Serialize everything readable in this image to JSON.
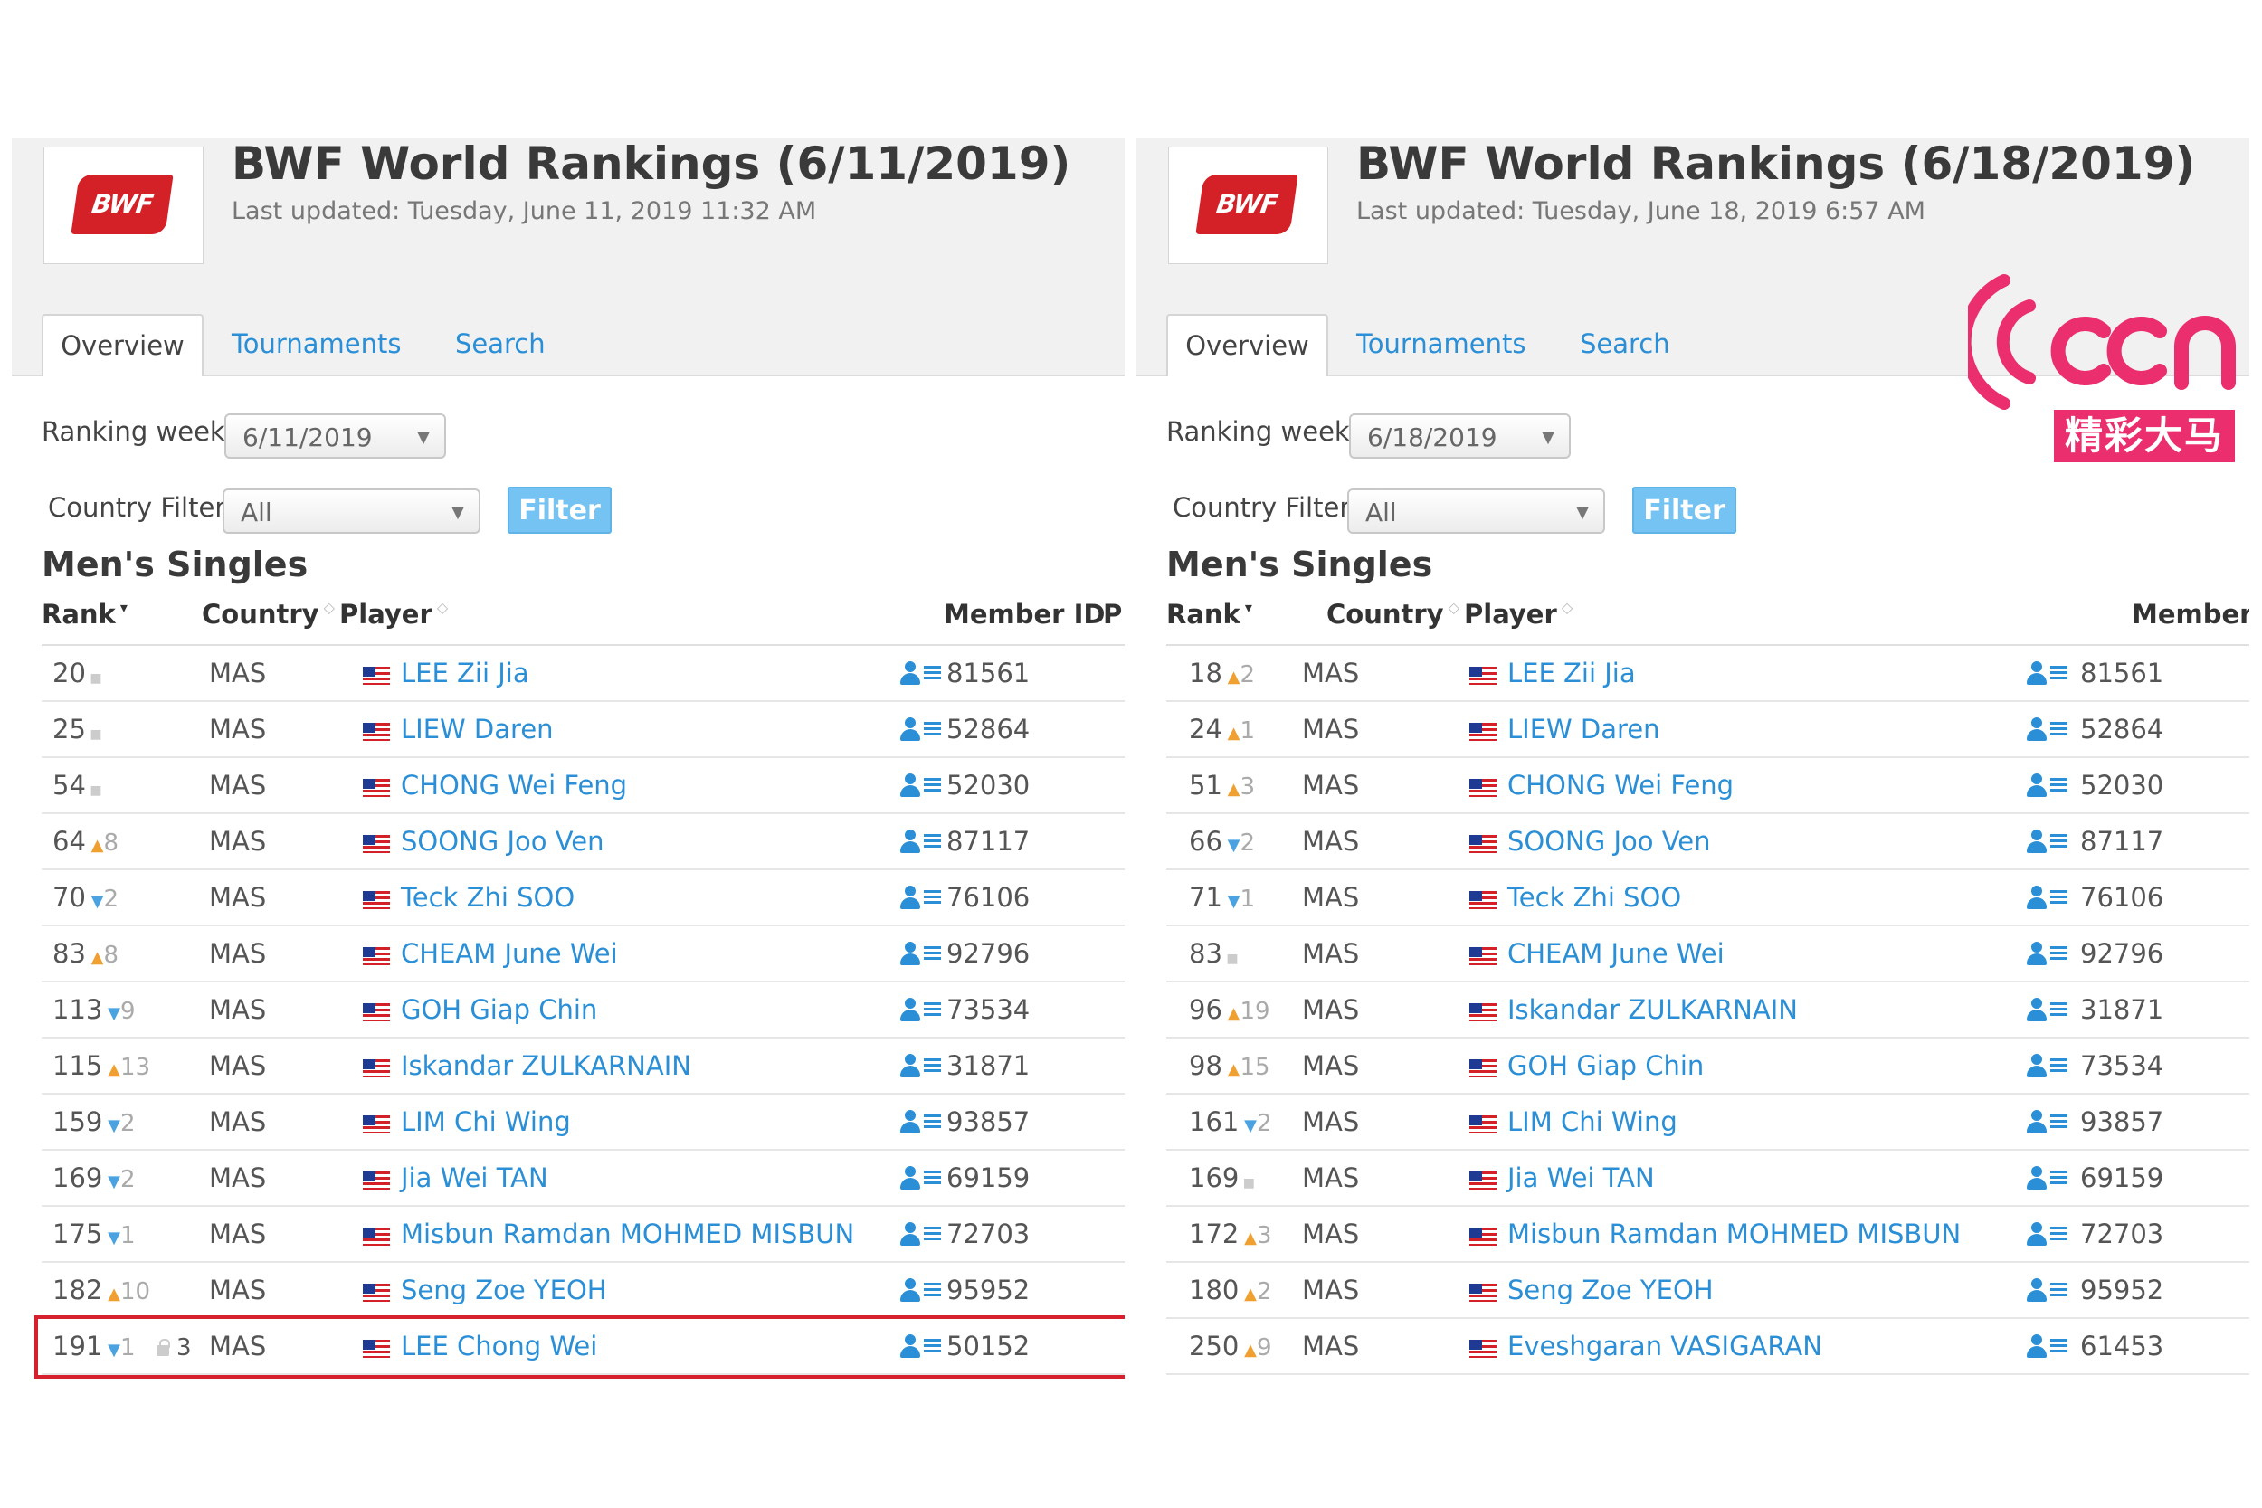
{
  "colors": {
    "link": "#2a8fd6",
    "brand_red": "#d42027",
    "filter_button": "#74c3f3",
    "highlight": "#d6202d",
    "up_arrow": "#f0a030",
    "down_arrow": "#4aa3e0",
    "ccn_pink": "#ea2e6e"
  },
  "icons": {
    "logo": "bwf-logo",
    "profile": "profile-list-icon",
    "flag": "malaysia-flag-icon",
    "sort": "sort-caret-icon",
    "dropdown": "caret-down-icon",
    "lock": "lock-icon",
    "watermark": "ccn-signal-logo"
  },
  "watermark": {
    "brand": "ccn",
    "label": "精彩大马"
  },
  "panels": [
    {
      "logo_text": "BWF",
      "title": "BWF World Rankings (6/11/2019)",
      "last_updated": "Last updated: Tuesday, June 11, 2019 11:32 AM",
      "tabs": {
        "overview": "Overview",
        "tournaments": "Tournaments",
        "search": "Search"
      },
      "ranking_week_label": "Ranking week:",
      "ranking_week_value": "6/11/2019",
      "country_filter_label": "Country Filter:",
      "country_filter_value": "All",
      "filter_button": "Filter",
      "section_title": "Men's Singles",
      "columns": {
        "rank": "Rank",
        "country": "Country",
        "player": "Player",
        "member_id": "Member ID",
        "extra": "P"
      },
      "rows": [
        {
          "rank": "20",
          "change": "",
          "dir": "none",
          "country": "MAS",
          "player": "LEE Zii Jia",
          "member_id": "81561"
        },
        {
          "rank": "25",
          "change": "",
          "dir": "none",
          "country": "MAS",
          "player": "LIEW Daren",
          "member_id": "52864"
        },
        {
          "rank": "54",
          "change": "",
          "dir": "none",
          "country": "MAS",
          "player": "CHONG Wei Feng",
          "member_id": "52030"
        },
        {
          "rank": "64",
          "change": "8",
          "dir": "up",
          "country": "MAS",
          "player": "SOONG Joo Ven",
          "member_id": "87117"
        },
        {
          "rank": "70",
          "change": "2",
          "dir": "down",
          "country": "MAS",
          "player": "Teck Zhi SOO",
          "member_id": "76106"
        },
        {
          "rank": "83",
          "change": "8",
          "dir": "up",
          "country": "MAS",
          "player": "CHEAM June Wei",
          "member_id": "92796"
        },
        {
          "rank": "113",
          "change": "9",
          "dir": "down",
          "country": "MAS",
          "player": "GOH Giap Chin",
          "member_id": "73534"
        },
        {
          "rank": "115",
          "change": "13",
          "dir": "up",
          "country": "MAS",
          "player": "Iskandar ZULKARNAIN",
          "member_id": "31871"
        },
        {
          "rank": "159",
          "change": "2",
          "dir": "down",
          "country": "MAS",
          "player": "LIM Chi Wing",
          "member_id": "93857"
        },
        {
          "rank": "169",
          "change": "2",
          "dir": "down",
          "country": "MAS",
          "player": "Jia Wei TAN",
          "member_id": "69159"
        },
        {
          "rank": "175",
          "change": "1",
          "dir": "down",
          "country": "MAS",
          "player": "Misbun Ramdan MOHMED MISBUN",
          "member_id": "72703"
        },
        {
          "rank": "182",
          "change": "10",
          "dir": "up",
          "country": "MAS",
          "player": "Seng Zoe YEOH",
          "member_id": "95952"
        },
        {
          "rank": "191",
          "change": "1",
          "dir": "down",
          "extra": "3",
          "country": "MAS",
          "player": "LEE Chong Wei",
          "member_id": "50152",
          "highlight": true
        }
      ]
    },
    {
      "logo_text": "BWF",
      "title": "BWF World Rankings (6/18/2019)",
      "last_updated": "Last updated: Tuesday, June 18, 2019 6:57 AM",
      "tabs": {
        "overview": "Overview",
        "tournaments": "Tournaments",
        "search": "Search"
      },
      "ranking_week_label": "Ranking week:",
      "ranking_week_value": "6/18/2019",
      "country_filter_label": "Country Filter:",
      "country_filter_value": "All",
      "filter_button": "Filter",
      "section_title": "Men's Singles",
      "columns": {
        "rank": "Rank",
        "country": "Country",
        "player": "Player",
        "member_id": "Member I",
        "extra": ""
      },
      "rows": [
        {
          "rank": "18",
          "change": "2",
          "dir": "up",
          "country": "MAS",
          "player": "LEE Zii Jia",
          "member_id": "81561"
        },
        {
          "rank": "24",
          "change": "1",
          "dir": "up",
          "country": "MAS",
          "player": "LIEW Daren",
          "member_id": "52864"
        },
        {
          "rank": "51",
          "change": "3",
          "dir": "up",
          "country": "MAS",
          "player": "CHONG Wei Feng",
          "member_id": "52030"
        },
        {
          "rank": "66",
          "change": "2",
          "dir": "down",
          "country": "MAS",
          "player": "SOONG Joo Ven",
          "member_id": "87117"
        },
        {
          "rank": "71",
          "change": "1",
          "dir": "down",
          "country": "MAS",
          "player": "Teck Zhi SOO",
          "member_id": "76106"
        },
        {
          "rank": "83",
          "change": "",
          "dir": "none",
          "country": "MAS",
          "player": "CHEAM June Wei",
          "member_id": "92796"
        },
        {
          "rank": "96",
          "change": "19",
          "dir": "up",
          "country": "MAS",
          "player": "Iskandar ZULKARNAIN",
          "member_id": "31871"
        },
        {
          "rank": "98",
          "change": "15",
          "dir": "up",
          "country": "MAS",
          "player": "GOH Giap Chin",
          "member_id": "73534"
        },
        {
          "rank": "161",
          "change": "2",
          "dir": "down",
          "country": "MAS",
          "player": "LIM Chi Wing",
          "member_id": "93857"
        },
        {
          "rank": "169",
          "change": "",
          "dir": "none",
          "country": "MAS",
          "player": "Jia Wei TAN",
          "member_id": "69159"
        },
        {
          "rank": "172",
          "change": "3",
          "dir": "up",
          "country": "MAS",
          "player": "Misbun Ramdan MOHMED MISBUN",
          "member_id": "72703"
        },
        {
          "rank": "180",
          "change": "2",
          "dir": "up",
          "country": "MAS",
          "player": "Seng Zoe YEOH",
          "member_id": "95952"
        },
        {
          "rank": "250",
          "change": "9",
          "dir": "up",
          "country": "MAS",
          "player": "Eveshgaran VASIGARAN",
          "member_id": "61453"
        }
      ]
    }
  ]
}
